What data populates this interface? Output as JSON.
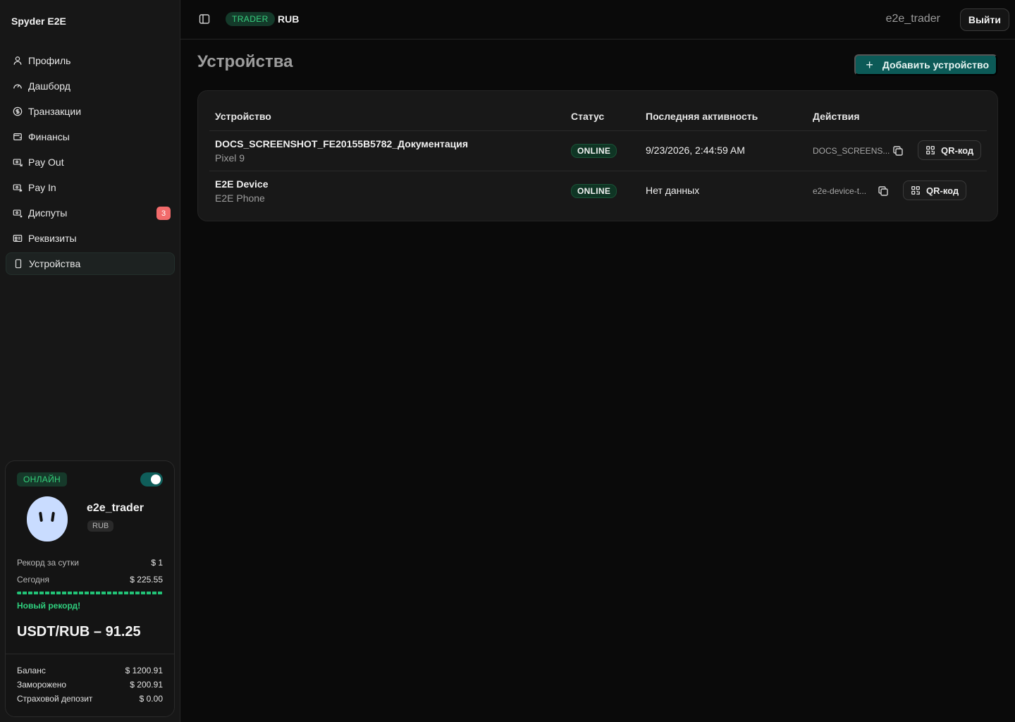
{
  "sidebar": {
    "brand": "Spyder E2E",
    "items": [
      {
        "label": "Профиль",
        "icon": "user-icon"
      },
      {
        "label": "Дашборд",
        "icon": "gauge-icon"
      },
      {
        "label": "Транзакции",
        "icon": "dollar-icon"
      },
      {
        "label": "Финансы",
        "icon": "wallet-icon"
      },
      {
        "label": "Pay Out",
        "icon": "payout-icon"
      },
      {
        "label": "Pay In",
        "icon": "payin-icon"
      },
      {
        "label": "Диспуты",
        "icon": "dispute-icon",
        "badge": "3"
      },
      {
        "label": "Реквизиты",
        "icon": "id-card-icon"
      },
      {
        "label": "Устройства",
        "icon": "smartphone-icon",
        "active": true
      }
    ]
  },
  "user_card": {
    "status": "ОНЛАЙН",
    "online_toggle": true,
    "username": "e2e_trader",
    "currency": "RUB",
    "record_label": "Рекорд за сутки",
    "record_value": "$ 1",
    "today_label": "Сегодня",
    "today_value": "$ 225.55",
    "new_record": "Новый рекорд!",
    "rate": "USDT/RUB – 91.25",
    "balance_label": "Баланс",
    "balance_value": "$ 1200.91",
    "frozen_label": "Заморожено",
    "frozen_value": "$ 200.91",
    "deposit_label": "Страховой депозит",
    "deposit_value": "$ 0.00"
  },
  "header": {
    "role": "TRADER",
    "currency": "RUB",
    "username": "e2e_trader",
    "logout_label": "Выйти"
  },
  "page": {
    "title": "Устройства",
    "add_button": "Добавить устройство"
  },
  "table": {
    "columns": [
      "Устройство",
      "Статус",
      "Последняя активность",
      "Действия"
    ],
    "rows": [
      {
        "name": "DOCS_SCREENSHOT_FE20155B5782_Документация",
        "model": "Pixel 9",
        "status": "ONLINE",
        "last_activity": "9/23/2026, 2:44:59 AM",
        "device_id": "DOCS_SCREENS...",
        "qr_label": "QR-код"
      },
      {
        "name": "E2E Device",
        "model": "E2E Phone",
        "status": "ONLINE",
        "last_activity": "Нет данных",
        "device_id": "e2e-device-t...",
        "qr_label": "QR-код"
      }
    ]
  },
  "colors": {
    "accent": "#0c5a57",
    "online_green": "#34d27b",
    "badge_red": "#f26b6b"
  }
}
